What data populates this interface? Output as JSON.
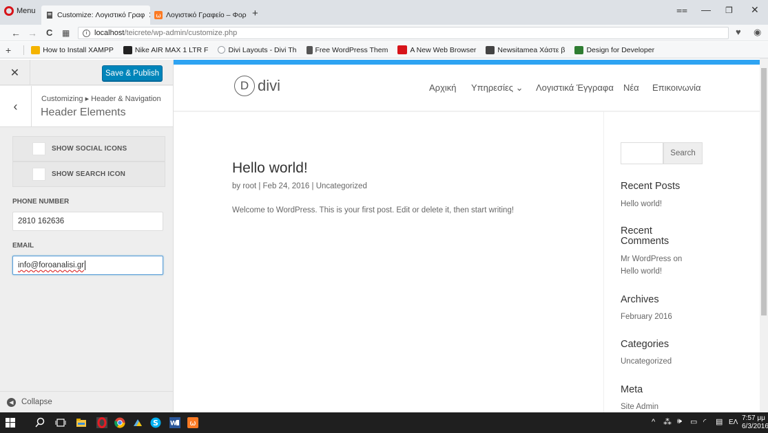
{
  "browser": {
    "menu_label": "Menu",
    "tabs": [
      {
        "label": "Customize: Λογιστικό Γραφ",
        "active": true
      },
      {
        "label": "Λογιστικό Γραφείο – Φορ",
        "active": false
      }
    ],
    "new_tab": "+",
    "url_host": "localhost",
    "url_path": "/teicrete/wp-admin/customize.php",
    "bookmarks": [
      {
        "label": "How to Install XAMPP",
        "color": "#f5b400"
      },
      {
        "label": "Nike AIR MAX 1 LTR F",
        "color": "#222222"
      },
      {
        "label": "Divi Layouts - Divi Th",
        "color": "#9aa0a6"
      },
      {
        "label": "Free WordPress Them",
        "color": "#555555"
      },
      {
        "label": "A New Web Browser",
        "color": "#d7141a"
      },
      {
        "label": "Newsitamea Χάστε β",
        "color": "#444444"
      },
      {
        "label": "Design for Developer",
        "color": "#2f7d32"
      }
    ]
  },
  "customizer": {
    "save_label": "Save & Publish",
    "breadcrumb": "Customizing ▸ Header & Navigation",
    "section_title": "Header Elements",
    "checkboxes": [
      {
        "label": "SHOW SOCIAL ICONS",
        "checked": false
      },
      {
        "label": "SHOW SEARCH ICON",
        "checked": false
      }
    ],
    "phone_label": "PHONE NUMBER",
    "phone_value": "2810 162636",
    "email_label": "EMAIL",
    "email_value": "info@foroanalisi.gr",
    "collapse_label": "Collapse",
    "accent": "#0085ba"
  },
  "site": {
    "logo_letter": "D",
    "logo_text": "divi",
    "menu": [
      "Αρχική",
      "Υπηρεσίες ⌄",
      "Λογιστικά Έγγραφα",
      "Νέα",
      "Επικοινωνία"
    ],
    "post": {
      "title": "Hello world!",
      "meta": "by root | Feb 24, 2016 | Uncategorized",
      "body": "Welcome to WordPress. This is your first post. Edit or delete it, then start writing!"
    },
    "search_button": "Search",
    "widgets": {
      "recent_posts_title": "Recent Posts",
      "recent_posts_item": "Hello world!",
      "recent_comments_title_1": "Recent",
      "recent_comments_title_2": "Comments",
      "recent_comments_item_1": "Mr WordPress on",
      "recent_comments_item_2": "Hello world!",
      "archives_title": "Archives",
      "archives_item": "February 2016",
      "categories_title": "Categories",
      "categories_item": "Uncategorized",
      "meta_title": "Meta",
      "meta_item": "Site Admin"
    },
    "topbar_color": "#2ea3f2"
  },
  "taskbar": {
    "lang": "ΕΛ",
    "time": "7:57 μμ",
    "date": "6/3/2016"
  }
}
